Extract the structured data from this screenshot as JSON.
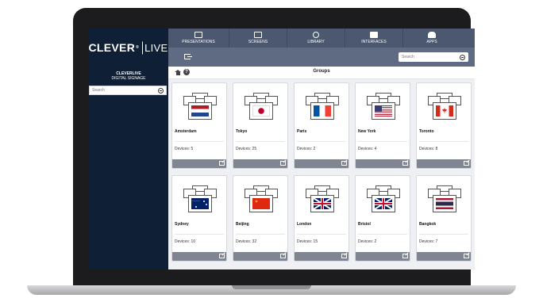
{
  "brand": {
    "name": "CLEVER",
    "mark": "®",
    "live": "LIVE"
  },
  "sidebar": {
    "title_line1": "CLEVERLIVE",
    "title_line2": "DIGITAL SIGNAGE",
    "search_placeholder": "Search"
  },
  "nav": {
    "items": [
      {
        "label": "PRESENTATIONS",
        "icon": "presentation-icon"
      },
      {
        "label": "SCREENS",
        "icon": "monitor-icon"
      },
      {
        "label": "LIBRARY",
        "icon": "library-icon"
      },
      {
        "label": "INTERFACES",
        "icon": "users-icon"
      },
      {
        "label": "APPS",
        "icon": "android-icon"
      }
    ]
  },
  "subbar": {
    "search_placeholder": "Search"
  },
  "page": {
    "title": "Groups"
  },
  "groups": [
    {
      "name": "Amsterdam",
      "devices": "Devices: 5",
      "flag": "netherlands"
    },
    {
      "name": "Tokyo",
      "devices": "Devices: 25",
      "flag": "japan"
    },
    {
      "name": "Paris",
      "devices": "Devices: 2",
      "flag": "france"
    },
    {
      "name": "New York",
      "devices": "Devices: 4",
      "flag": "usa"
    },
    {
      "name": "Toronto",
      "devices": "Devices: 8",
      "flag": "canada"
    },
    {
      "name": "Sydney",
      "devices": "Devices: 10",
      "flag": "australia"
    },
    {
      "name": "Beijing",
      "devices": "Devices: 32",
      "flag": "china"
    },
    {
      "name": "London",
      "devices": "Devices: 15",
      "flag": "uk"
    },
    {
      "name": "Bristol",
      "devices": "Devices: 2",
      "flag": "uk"
    },
    {
      "name": "Bangkok",
      "devices": "Devices: 7",
      "flag": "thailand"
    }
  ],
  "colors": {
    "sidebar": "#0f2036",
    "nav": "#4b5870",
    "subbar": "#5f6b82",
    "card_footer": "#7f8591"
  }
}
